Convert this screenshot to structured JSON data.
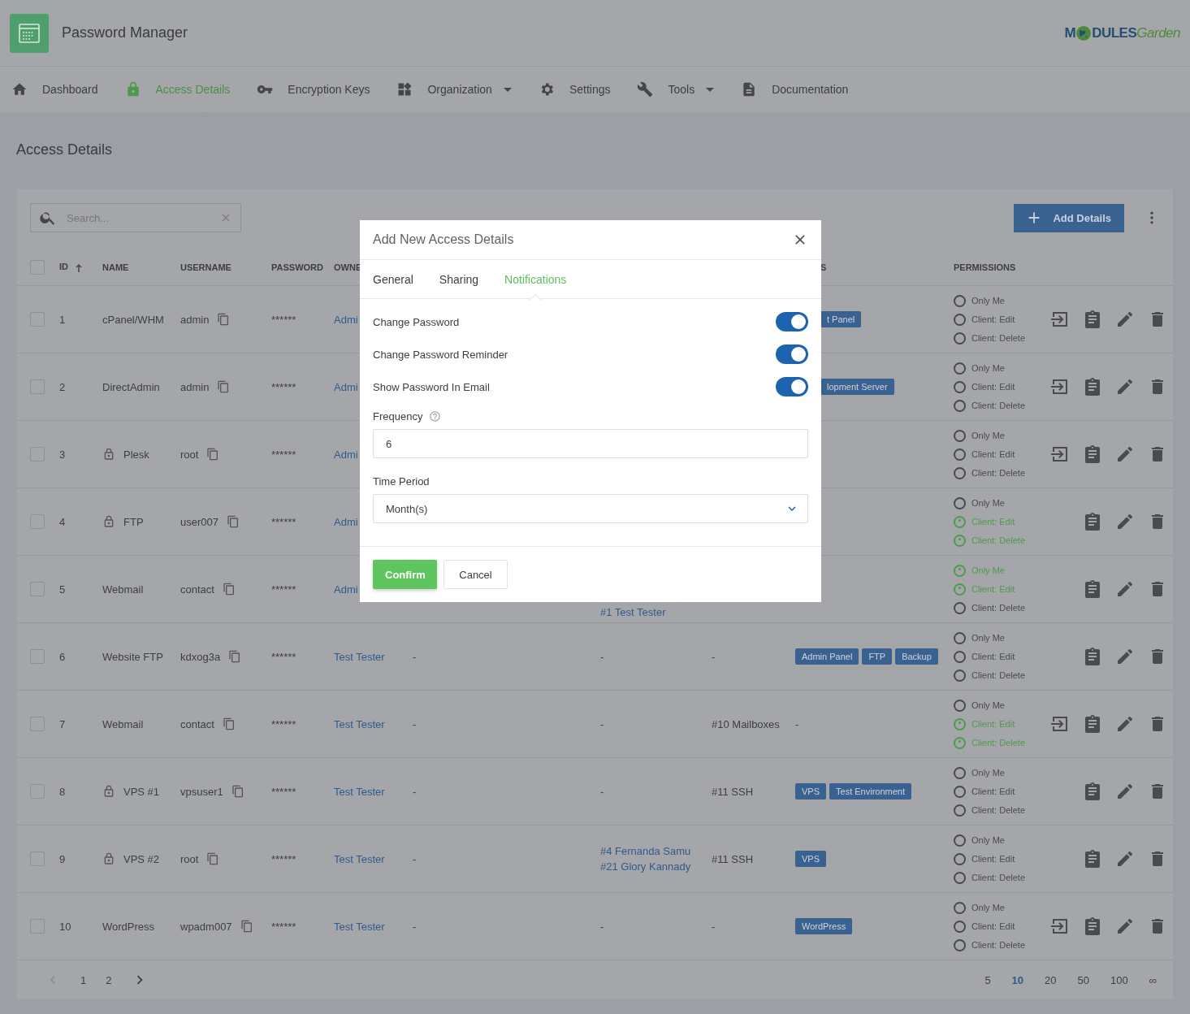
{
  "app": {
    "title": "Password Manager",
    "logo": {
      "lead": "M",
      "main": "DULES",
      "script": "Garden"
    }
  },
  "nav": [
    {
      "label": "Dashboard",
      "kind": "home",
      "selected": false,
      "has_menu": false
    },
    {
      "label": "Access Details",
      "kind": "lock",
      "selected": true,
      "has_menu": false
    },
    {
      "label": "Encryption Keys",
      "kind": "key",
      "selected": false,
      "has_menu": false
    },
    {
      "label": "Organization",
      "kind": "widgets",
      "selected": false,
      "has_menu": true
    },
    {
      "label": "Settings",
      "kind": "gear",
      "selected": false,
      "has_menu": false
    },
    {
      "label": "Tools",
      "kind": "wrench",
      "selected": false,
      "has_menu": true
    },
    {
      "label": "Documentation",
      "kind": "document",
      "selected": false,
      "has_menu": false
    }
  ],
  "page_title": "Access Details",
  "toolbar": {
    "search": {
      "placeholder": "Search..."
    },
    "add_button": "Add Details"
  },
  "table": {
    "select_all_checked": false,
    "columns": [
      {
        "label": "ID",
        "sorted": true
      },
      {
        "label": "NAME",
        "sorted": false
      },
      {
        "label": "USERNAME",
        "sorted": false
      },
      {
        "label": "PASSWORD",
        "sorted": false
      },
      {
        "label": "OWNE",
        "sorted": false
      },
      {
        "label": "S",
        "sorted": false
      },
      {
        "label": "PERMISSIONS",
        "sorted": false
      }
    ],
    "rows": [
      {
        "checked": false,
        "id": "1",
        "name": "cPanel/WHM",
        "locked": false,
        "username": "admin",
        "password": "******",
        "owner": "Admi",
        "column_9": {
          "kind": "tags",
          "items": [
            "t Panel"
          ]
        },
        "permissions": [
          {
            "label": "Only Me",
            "on": false
          },
          {
            "label": "Client: Edit",
            "on": false
          },
          {
            "label": "Client: Delete",
            "on": false
          }
        ],
        "login": true
      },
      {
        "checked": false,
        "id": "2",
        "name": "DirectAdmin",
        "locked": false,
        "username": "admin",
        "password": "******",
        "owner": "Admi",
        "column_9": {
          "kind": "tags",
          "items": [
            "lopment Server"
          ]
        },
        "permissions": [
          {
            "label": "Only Me",
            "on": false
          },
          {
            "label": "Client: Edit",
            "on": false
          },
          {
            "label": "Client: Delete",
            "on": false
          }
        ],
        "login": true
      },
      {
        "checked": false,
        "id": "3",
        "name": "Plesk",
        "locked": true,
        "username": "root",
        "password": "******",
        "owner": "Admi",
        "permissions": [
          {
            "label": "Only Me",
            "on": false
          },
          {
            "label": "Client: Edit",
            "on": false
          },
          {
            "label": "Client: Delete",
            "on": false
          }
        ],
        "login": true
      },
      {
        "checked": false,
        "id": "4",
        "name": "FTP",
        "locked": true,
        "username": "user007",
        "password": "******",
        "owner": "Admi",
        "permissions": [
          {
            "label": "Only Me",
            "on": false
          },
          {
            "label": "Client: Edit",
            "on": true
          },
          {
            "label": "Client: Delete",
            "on": true
          }
        ],
        "login": false
      },
      {
        "checked": false,
        "id": "5",
        "name": "Webmail",
        "locked": false,
        "username": "contact",
        "password": "******",
        "owner": "Admi",
        "column_7": [
          "#1 Test Tester"
        ],
        "permissions": [
          {
            "label": "Only Me",
            "on": true
          },
          {
            "label": "Client: Edit",
            "on": true
          },
          {
            "label": "Client: Delete",
            "on": false
          }
        ],
        "login": false
      },
      {
        "checked": false,
        "id": "6",
        "name": "Website FTP",
        "locked": false,
        "username": "kdxog3a",
        "password": "******",
        "owner": "Test Tester",
        "column_6": "-",
        "column_7": [
          "-"
        ],
        "column_8": "-",
        "column_9": {
          "kind": "tags",
          "items": [
            "Admin Panel",
            "FTP",
            "Backup"
          ]
        },
        "permissions": [
          {
            "label": "Only Me",
            "on": false
          },
          {
            "label": "Client: Edit",
            "on": false
          },
          {
            "label": "Client: Delete",
            "on": false
          }
        ],
        "login": false
      },
      {
        "checked": false,
        "id": "7",
        "name": "Webmail",
        "locked": false,
        "username": "contact",
        "password": "******",
        "owner": "Test Tester",
        "column_6": "-",
        "column_7": [
          "-"
        ],
        "column_8": "#10 Mailboxes",
        "column_9": {
          "kind": "text",
          "text": "-"
        },
        "permissions": [
          {
            "label": "Only Me",
            "on": false
          },
          {
            "label": "Client: Edit",
            "on": true
          },
          {
            "label": "Client: Delete",
            "on": true
          }
        ],
        "login": true
      },
      {
        "checked": false,
        "id": "8",
        "name": "VPS #1",
        "locked": true,
        "username": "vpsuser1",
        "password": "******",
        "owner": "Test Tester",
        "column_6": "-",
        "column_7": [
          "-"
        ],
        "column_8": "#11 SSH",
        "column_9": {
          "kind": "tags",
          "items": [
            "VPS",
            "Test Environment"
          ]
        },
        "permissions": [
          {
            "label": "Only Me",
            "on": false
          },
          {
            "label": "Client: Edit",
            "on": false
          },
          {
            "label": "Client: Delete",
            "on": false
          }
        ],
        "login": false
      },
      {
        "checked": false,
        "id": "9",
        "name": "VPS #2",
        "locked": true,
        "username": "root",
        "password": "******",
        "owner": "Test Tester",
        "column_6": "-",
        "column_7": [
          "#4 Fernanda Samu",
          "#21 Glory Kannady"
        ],
        "column_8": "#11 SSH",
        "column_9": {
          "kind": "tags",
          "items": [
            "VPS"
          ]
        },
        "permissions": [
          {
            "label": "Only Me",
            "on": false
          },
          {
            "label": "Client: Edit",
            "on": false
          },
          {
            "label": "Client: Delete",
            "on": false
          }
        ],
        "login": false
      },
      {
        "checked": false,
        "id": "10",
        "name": "WordPress",
        "locked": false,
        "username": "wpadm007",
        "password": "******",
        "owner": "Test Tester",
        "column_6": "-",
        "column_7": [
          "-"
        ],
        "column_8": "-",
        "column_9": {
          "kind": "tags",
          "items": [
            "WordPress"
          ]
        },
        "permissions": [
          {
            "label": "Only Me",
            "on": false
          },
          {
            "label": "Client: Edit",
            "on": false
          },
          {
            "label": "Client: Delete",
            "on": false
          }
        ],
        "login": true
      }
    ]
  },
  "pagination": {
    "prev_disabled": true,
    "pages": [
      {
        "label": "1",
        "selected": false
      },
      {
        "label": "2",
        "selected": false
      }
    ],
    "page_sizes": [
      {
        "label": "5",
        "selected": false
      },
      {
        "label": "10",
        "selected": true
      },
      {
        "label": "20",
        "selected": false
      },
      {
        "label": "50",
        "selected": false
      },
      {
        "label": "100",
        "selected": false
      },
      {
        "label": "∞",
        "selected": false
      }
    ]
  },
  "modal": {
    "title": "Add New Access Details",
    "tabs": [
      {
        "label": "General",
        "selected": false
      },
      {
        "label": "Sharing",
        "selected": false
      },
      {
        "label": "Notifications",
        "selected": true
      }
    ],
    "toggles": [
      {
        "label": "Change Password",
        "on": true
      },
      {
        "label": "Change Password Reminder",
        "on": true
      },
      {
        "label": "Show Password In Email",
        "on": true
      }
    ],
    "frequency": {
      "label": "Frequency",
      "value": "6"
    },
    "time_period": {
      "label": "Time Period",
      "value": "Month(s)"
    },
    "buttons": [
      {
        "label": "Confirm",
        "kind": "primary"
      },
      {
        "label": "Cancel",
        "kind": "secondary"
      }
    ]
  }
}
